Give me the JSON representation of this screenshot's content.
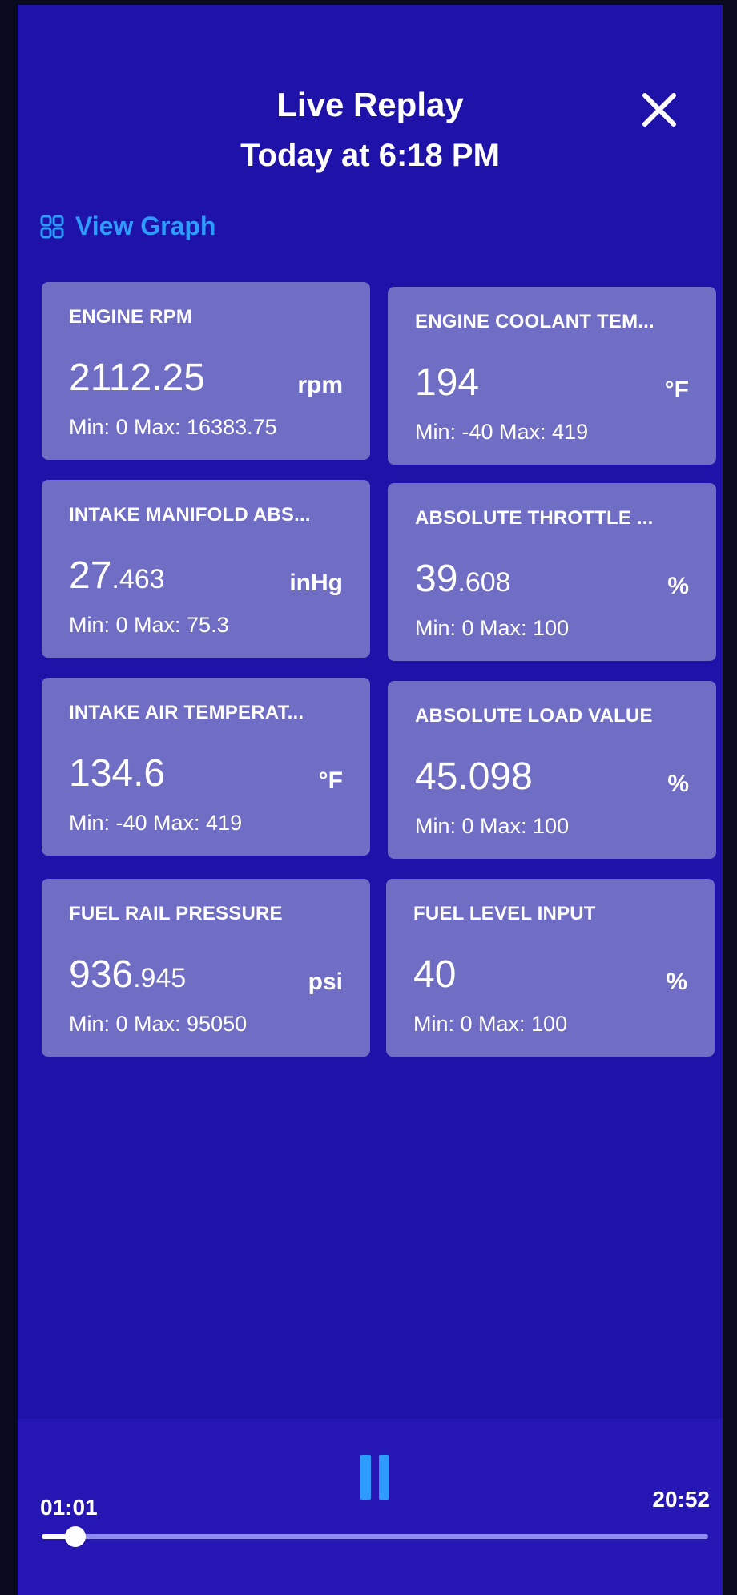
{
  "header": {
    "title": "Live Replay",
    "subtitle": "Today at 6:18 PM"
  },
  "toolbar": {
    "view_graph_label": "View Graph"
  },
  "icons": {
    "close": "close-icon",
    "grid": "grid-icon",
    "pause": "pause-icon"
  },
  "colors": {
    "background": "#1f12a8",
    "card": "#6f6dc4",
    "accent": "#2e9bff",
    "text": "#ffffff"
  },
  "cards": [
    {
      "label": "ENGINE RPM",
      "value_int": "2112",
      "value_dec": ".25",
      "unit": "rpm",
      "range": "Min: 0 Max: 16383.75"
    },
    {
      "label": "ENGINE COOLANT TEM...",
      "value_int": "194",
      "value_dec": "",
      "unit": "°F",
      "range": "Min: -40 Max: 419"
    },
    {
      "label": "INTAKE MANIFOLD ABS...",
      "value_int": "27",
      "value_dec": ".463",
      "unit": "inHg",
      "range": "Min: 0 Max: 75.3"
    },
    {
      "label": "ABSOLUTE THROTTLE ...",
      "value_int": "39",
      "value_dec": ".608",
      "unit": "%",
      "range": "Min: 0 Max: 100"
    },
    {
      "label": "INTAKE AIR TEMPERAT...",
      "value_int": "134",
      "value_dec": ".6",
      "unit": "°F",
      "range": "Min: -40 Max: 419"
    },
    {
      "label": "ABSOLUTE LOAD VALUE",
      "value_int": "45",
      "value_dec": ".098",
      "unit": "%",
      "range": "Min: 0 Max: 100"
    },
    {
      "label": "FUEL RAIL PRESSURE",
      "value_int": "936",
      "value_dec": ".945",
      "unit": "psi",
      "range": "Min: 0 Max: 95050"
    },
    {
      "label": "FUEL LEVEL INPUT",
      "value_int": "40",
      "value_dec": "",
      "unit": "%",
      "range": "Min: 0 Max: 100"
    }
  ],
  "player": {
    "elapsed": "01:01",
    "total": "20:52",
    "progress": 0.05
  }
}
